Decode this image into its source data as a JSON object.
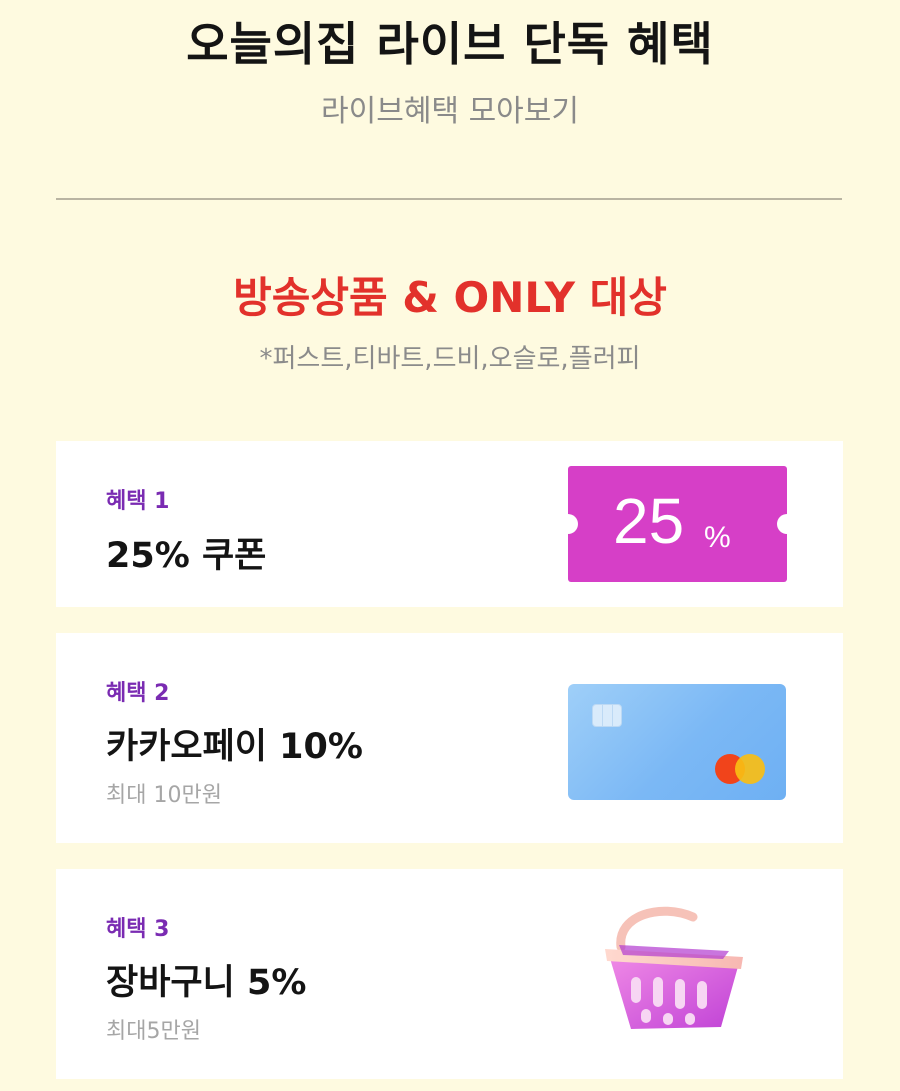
{
  "header": {
    "title": "오늘의집 라이브 단독 혜택",
    "subtitle": "라이브혜택 모아보기"
  },
  "section": {
    "title": "방송상품 & ONLY 대상",
    "note": "*퍼스트,티바트,드비,오슬로,플러피"
  },
  "benefits": [
    {
      "label": "혜택 1",
      "title": "25% 쿠폰",
      "coupon_value": "25",
      "coupon_unit": "%",
      "coupon_color": "#d63fc7"
    },
    {
      "label": "혜택 2",
      "title": "카카오페이 10%",
      "subtitle": "최대 10만원",
      "card_color": "#7bb8f5"
    },
    {
      "label": "혜택 3",
      "title": "장바구니 5%",
      "subtitle": "최대5만원",
      "icon": "shopping-basket-icon"
    }
  ],
  "colors": {
    "background": "#fefae0",
    "accent_red": "#e2312b",
    "label_purple": "#7a2bb2"
  }
}
